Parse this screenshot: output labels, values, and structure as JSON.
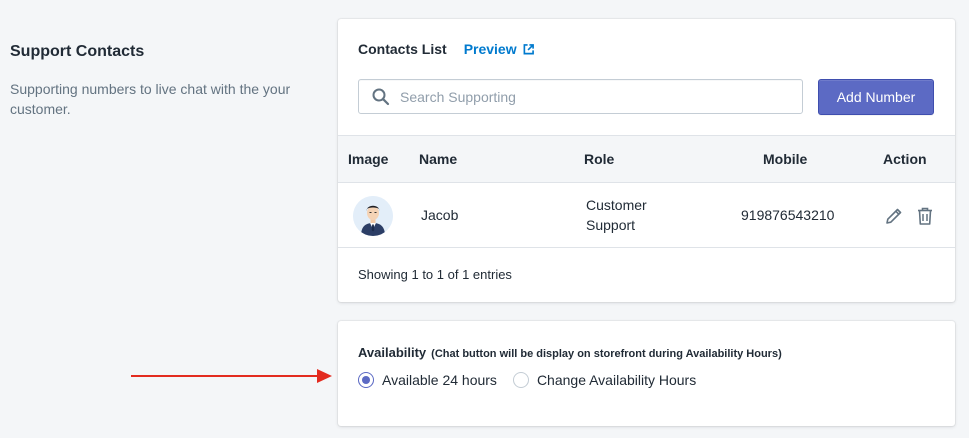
{
  "section": {
    "title": "Support Contacts",
    "description": "Supporting numbers to live chat with the your customer."
  },
  "contacts_card": {
    "title": "Contacts List",
    "preview_label": "Preview",
    "search_placeholder": "Search Supporting",
    "search_value": "",
    "add_button_label": "Add Number",
    "columns": {
      "image": "Image",
      "name": "Name",
      "role": "Role",
      "mobile": "Mobile",
      "action": "Action"
    },
    "rows": [
      {
        "avatar_icon": "user-avatar-icon",
        "name": "Jacob",
        "role": "Customer Support",
        "mobile": "919876543210",
        "actions": [
          "edit-icon",
          "trash-icon"
        ]
      }
    ],
    "footer": "Showing 1 to 1 of 1 entries"
  },
  "availability": {
    "title": "Availability",
    "note": "(Chat button will be display on storefront during Availability Hours)",
    "options": [
      {
        "label": "Available 24 hours",
        "selected": true
      },
      {
        "label": "Change Availability Hours",
        "selected": false
      }
    ]
  },
  "colors": {
    "primary": "#5c6ac4",
    "link": "#007ace",
    "annotation_arrow": "#e32b1f",
    "background": "#f4f6f8"
  }
}
